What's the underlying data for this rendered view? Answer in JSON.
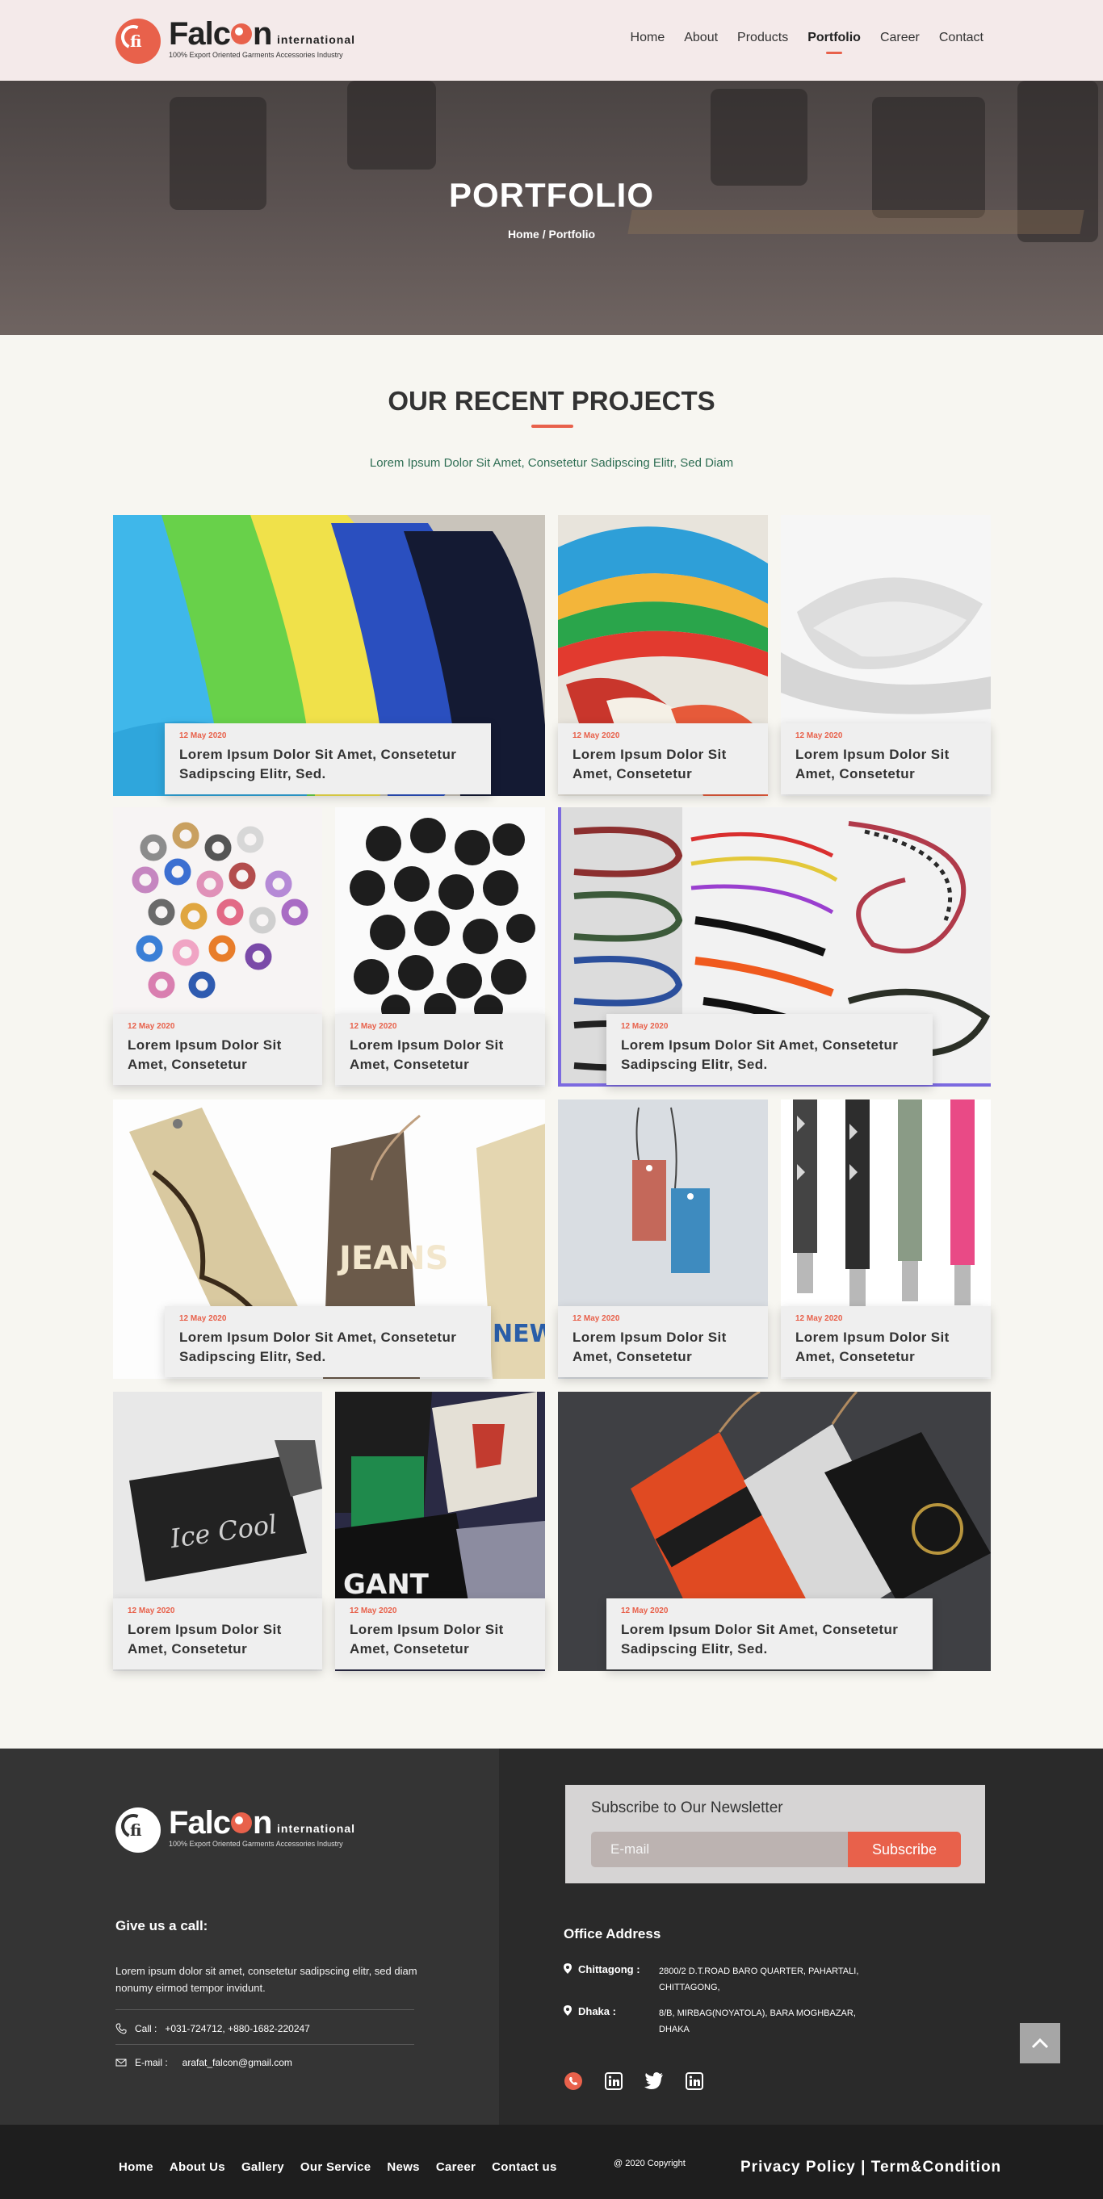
{
  "brand": {
    "mark_letters": "fi",
    "name": "Falc",
    "name_tail": "n",
    "suffix": "international",
    "tagline": "100% Export Oriented Garments Accessories Industry",
    "accent": "#e8614b"
  },
  "nav": {
    "items": [
      "Home",
      "About",
      "Products",
      "Portfolio",
      "Career",
      "Contact"
    ],
    "active": "Portfolio"
  },
  "hero": {
    "title": "PORTFOLIO",
    "crumb_home": "Home",
    "crumb_sep": " / ",
    "crumb_current": "Portfolio"
  },
  "section": {
    "title": "OUR RECENT PROJECTS",
    "subtitle": "Lorem Ipsum Dolor Sit Amet, Consetetur Sadipscing Elitr, Sed Diam"
  },
  "projects": [
    {
      "date": "12 May 2020",
      "title": "Lorem Ipsum Dolor Sit Amet, Consetetur Sadipscing Elitr, Sed.",
      "image": "folded-elastic-fabrics"
    },
    {
      "date": "12 May 2020",
      "title": "Lorem Ipsum Dolor Sit Amet, Consetetur",
      "image": "striped-elastic-tape"
    },
    {
      "date": "12 May 2020",
      "title": "Lorem Ipsum Dolor Sit Amet, Consetetur",
      "image": "white-elastic-band"
    },
    {
      "date": "12 May 2020",
      "title": "Lorem Ipsum Dolor Sit Amet, Consetetur",
      "image": "colored-eyelets"
    },
    {
      "date": "12 May 2020",
      "title": "Lorem Ipsum Dolor Sit Amet, Consetetur",
      "image": "black-cord-stoppers"
    },
    {
      "date": "12 May 2020",
      "title": "Lorem Ipsum Dolor Sit Amet, Consetetur Sadipscing Elitr, Sed.",
      "image": "cords-and-laces"
    },
    {
      "date": "12 May 2020",
      "title": "Lorem Ipsum Dolor Sit Amet, Consetetur Sadipscing Elitr, Sed.",
      "image": "printed-hang-tags"
    },
    {
      "date": "12 May 2020",
      "title": "Lorem Ipsum Dolor Sit Amet, Consetetur",
      "image": "label-mockup-tags"
    },
    {
      "date": "12 May 2020",
      "title": "Lorem Ipsum Dolor Sit Amet, Consetetur",
      "image": "patterned-shoelaces"
    },
    {
      "date": "12 May 2020",
      "title": "Lorem Ipsum Dolor Sit Amet, Consetetur",
      "image": "woven-label-ice-cool"
    },
    {
      "date": "12 May 2020",
      "title": "Lorem Ipsum Dolor Sit Amet, Consetetur",
      "image": "woven-brand-labels"
    },
    {
      "date": "12 May 2020",
      "title": "Lorem Ipsum Dolor Sit Amet, Consetetur Sadipscing Elitr, Sed.",
      "image": "revs-hang-tags"
    }
  ],
  "footer": {
    "call_heading": "Give us a call:",
    "call_text": "Lorem ipsum dolor sit amet, consetetur sadipscing elitr, sed diam nonumy eirmod tempor invidunt.",
    "call_label": "Call :",
    "call_value": "+031-724712, +880-1682-220247",
    "email_label": "E-mail :",
    "email_value": "arafat_falcon@gmail.com",
    "newsletter_title": "Subscribe to Our Newsletter",
    "newsletter_placeholder": "E-mail",
    "newsletter_button": "Subscribe",
    "office_heading": "Office Address",
    "offices": [
      {
        "city": "Chittagong :",
        "address": "2800/2 D.T.ROAD BARO QUARTER, PAHARTALI, CHITTAGONG,"
      },
      {
        "city": "Dhaka :",
        "address": "8/B, MIRBAG(NOYATOLA), BARA MOGHBAZAR, DHAKA"
      }
    ],
    "social": [
      "whatsapp-icon",
      "linkedin-icon",
      "twitter-icon",
      "linkedin-icon"
    ]
  },
  "bottom": {
    "links": [
      "Home",
      "About Us",
      "Gallery",
      "Our Service",
      "News",
      "Career",
      "Contact us"
    ],
    "copyright": "@ 2020 Copyright",
    "privacy": "Privacy Policy",
    "sep": " | ",
    "terms": "Term&Condition"
  }
}
